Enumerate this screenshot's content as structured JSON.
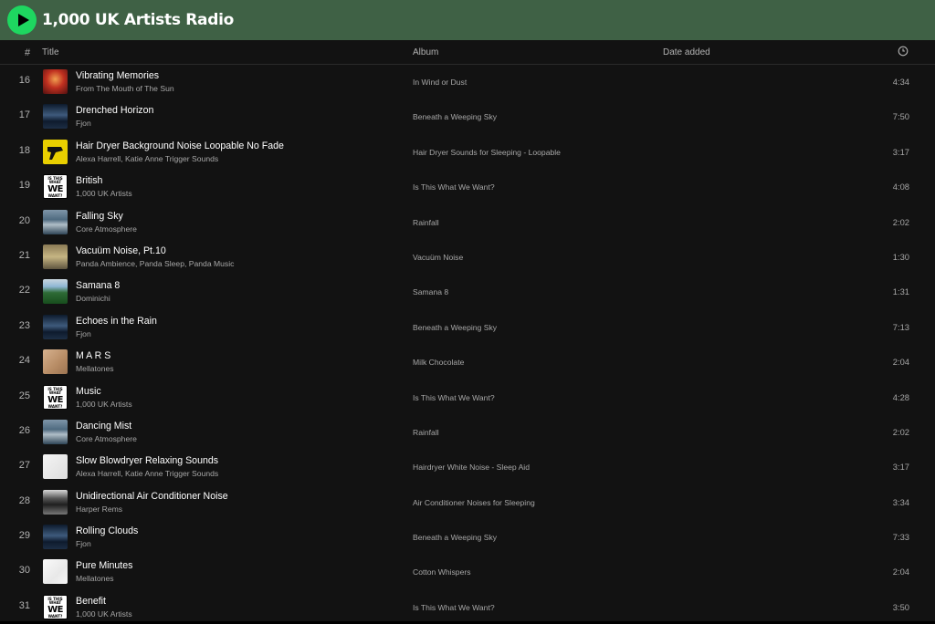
{
  "playlist": {
    "title": "1,000 UK Artists Radio"
  },
  "header": {
    "num": "#",
    "title": "Title",
    "album": "Album",
    "date_added": "Date added"
  },
  "colors": {
    "accent": "#1ed760",
    "topbar": "#3f6145",
    "background": "#121212"
  },
  "tracks": [
    {
      "num": "16",
      "title": "Vibrating Memories",
      "artist": "From The Mouth of The Sun",
      "album": "In Wind or Dust",
      "duration": "4:34",
      "cover": "red-gradient"
    },
    {
      "num": "17",
      "title": "Drenched Horizon",
      "artist": "Fjon",
      "album": "Beneath a Weeping Sky",
      "duration": "7:50",
      "cover": "storm"
    },
    {
      "num": "18",
      "title": "Hair Dryer Background Noise Loopable No Fade",
      "artist": "Alexa Harrell, Katie Anne Trigger Sounds",
      "album": "Hair Dryer Sounds for Sleeping - Loopable",
      "duration": "3:17",
      "cover": "yellow-hairdryer"
    },
    {
      "num": "19",
      "title": "British",
      "artist": "1,000 UK Artists",
      "album": "Is This What We Want?",
      "duration": "4:08",
      "cover": "we-want"
    },
    {
      "num": "20",
      "title": "Falling Sky",
      "artist": "Core Atmosphere",
      "album": "Rainfall",
      "duration": "2:02",
      "cover": "sky"
    },
    {
      "num": "21",
      "title": "Vacuüm Noise, Pt.10",
      "artist": "Panda Ambience, Panda Sleep, Panda Music",
      "album": "Vacuüm Noise",
      "duration": "1:30",
      "cover": "panda"
    },
    {
      "num": "22",
      "title": "Samana 8",
      "artist": "Dominichi",
      "album": "Samana 8",
      "duration": "1:31",
      "cover": "green-landscape"
    },
    {
      "num": "23",
      "title": "Echoes in the Rain",
      "artist": "Fjon",
      "album": "Beneath a Weeping Sky",
      "duration": "7:13",
      "cover": "storm"
    },
    {
      "num": "24",
      "title": "M A R S",
      "artist": "Mellatones",
      "album": "Milk Chocolate",
      "duration": "2:04",
      "cover": "brown"
    },
    {
      "num": "25",
      "title": "Music",
      "artist": "1,000 UK Artists",
      "album": "Is This What We Want?",
      "duration": "4:28",
      "cover": "we-want"
    },
    {
      "num": "26",
      "title": "Dancing Mist",
      "artist": "Core Atmosphere",
      "album": "Rainfall",
      "duration": "2:02",
      "cover": "sky"
    },
    {
      "num": "27",
      "title": "Slow Blowdryer Relaxing Sounds",
      "artist": "Alexa Harrell, Katie Anne Trigger Sounds",
      "album": "Hairdryer White Noise - Sleep Aid",
      "duration": "3:17",
      "cover": "white-portrait"
    },
    {
      "num": "28",
      "title": "Unidirectional Air Conditioner Noise",
      "artist": "Harper Rems",
      "album": "Air Conditioner Noises for Sleeping",
      "duration": "3:34",
      "cover": "air-conditioner"
    },
    {
      "num": "29",
      "title": "Rolling Clouds",
      "artist": "Fjon",
      "album": "Beneath a Weeping Sky",
      "duration": "7:33",
      "cover": "storm"
    },
    {
      "num": "30",
      "title": "Pure Minutes",
      "artist": "Mellatones",
      "album": "Cotton Whispers",
      "duration": "2:04",
      "cover": "cotton"
    },
    {
      "num": "31",
      "title": "Benefit",
      "artist": "1,000 UK Artists",
      "album": "Is This What We Want?",
      "duration": "3:50",
      "cover": "we-want"
    }
  ],
  "we_want_cover": {
    "top": "IS THIS WHAT",
    "big": "WE",
    "bottom": "WANT?"
  }
}
